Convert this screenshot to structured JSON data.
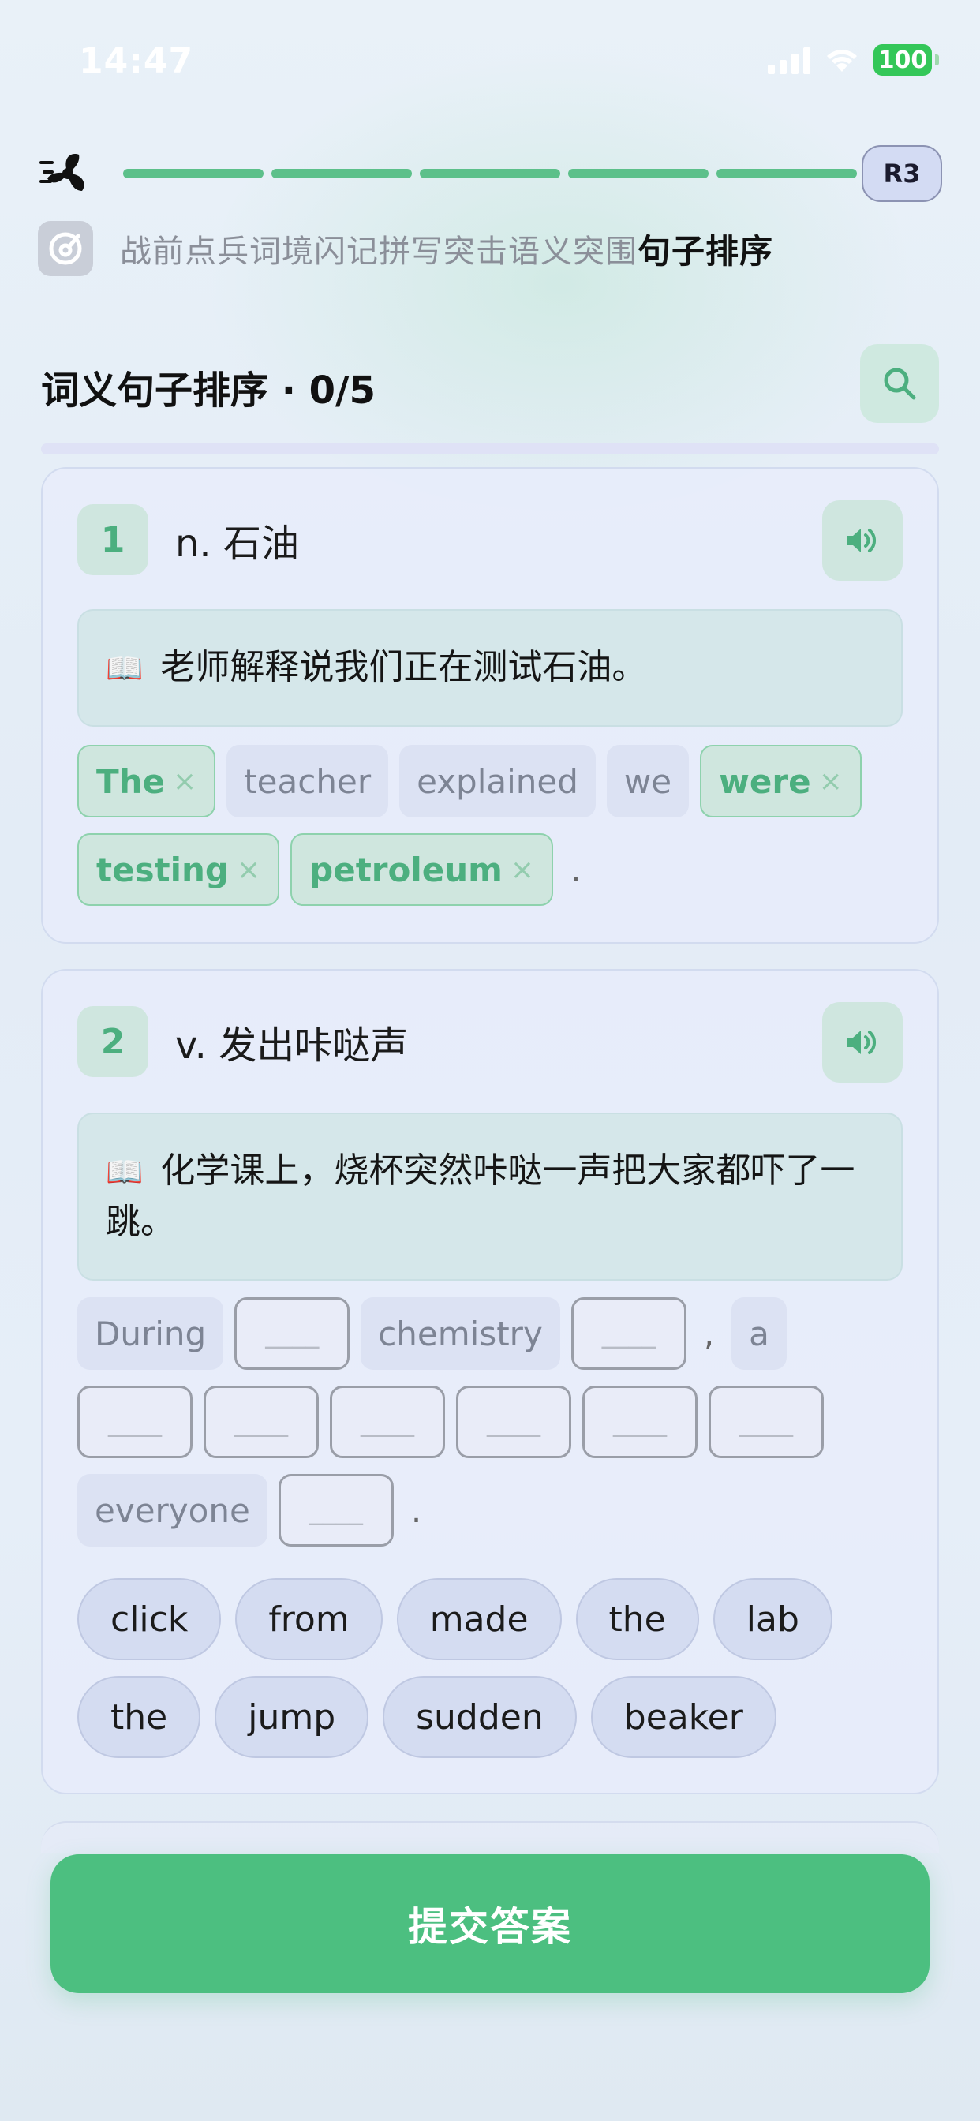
{
  "status_bar": {
    "time": "14:47",
    "battery": "100"
  },
  "progress": {
    "round_label": "R3",
    "segments": 5
  },
  "stages": {
    "completed_text": "战前点兵词境闪记拼写突击语义突围",
    "current": "句子排序"
  },
  "section": {
    "title": "词义句子排序 · 0/5"
  },
  "questions": [
    {
      "number": "1",
      "definition": "n. 石油",
      "sentence_zh": "老师解释说我们正在测试石油。",
      "tokens": [
        {
          "text": "The",
          "state": "correct"
        },
        {
          "text": "teacher",
          "state": "given"
        },
        {
          "text": "explained",
          "state": "given"
        },
        {
          "text": "we",
          "state": "given"
        },
        {
          "text": "were",
          "state": "correct"
        },
        {
          "text": "testing",
          "state": "correct"
        },
        {
          "text": "petroleum",
          "state": "correct"
        },
        {
          "text": ".",
          "state": "punct"
        }
      ]
    },
    {
      "number": "2",
      "definition": "v. 发出咔哒声",
      "sentence_zh": "化学课上，烧杯突然咔哒一声把大家都吓了一跳。",
      "tokens": [
        {
          "text": "During",
          "state": "given"
        },
        {
          "text": "",
          "state": "blank"
        },
        {
          "text": "chemistry",
          "state": "given"
        },
        {
          "text": "",
          "state": "blank"
        },
        {
          "text": ",",
          "state": "punct"
        },
        {
          "text": "a",
          "state": "given"
        },
        {
          "text": "",
          "state": "blank"
        },
        {
          "text": "",
          "state": "blank"
        },
        {
          "text": "",
          "state": "blank"
        },
        {
          "text": "",
          "state": "blank"
        },
        {
          "text": "",
          "state": "blank"
        },
        {
          "text": "",
          "state": "blank"
        },
        {
          "text": "everyone",
          "state": "given"
        },
        {
          "text": "",
          "state": "blank"
        },
        {
          "text": ".",
          "state": "punct"
        }
      ],
      "word_pool": [
        "click",
        "from",
        "made",
        "the",
        "lab",
        "the",
        "jump",
        "sudden",
        "beaker"
      ]
    }
  ],
  "submit": {
    "label": "提交答案"
  },
  "colors": {
    "accent": "#4cbf80",
    "correct_text": "#4caf7f",
    "given_text": "#7d8494"
  }
}
